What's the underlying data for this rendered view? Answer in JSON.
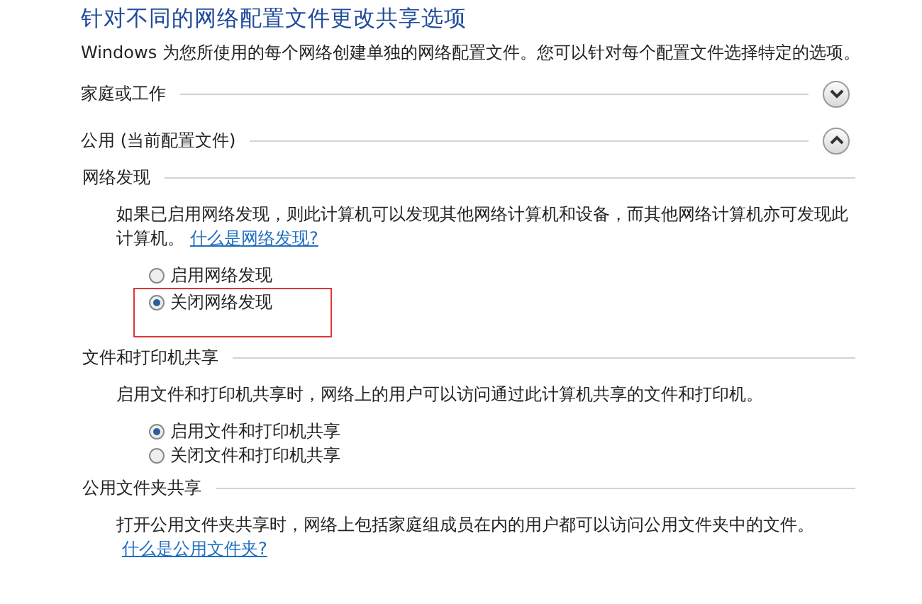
{
  "title": "针对不同的网络配置文件更改共享选项",
  "description": "Windows 为您所使用的每个网络创建单独的网络配置文件。您可以针对每个配置文件选择特定的选项。",
  "profiles": [
    {
      "label": "家庭或工作",
      "expanded": false
    },
    {
      "label": "公用 (当前配置文件)",
      "expanded": true,
      "sections": [
        {
          "heading": "网络发现",
          "text": "如果已启用网络发现，则此计算机可以发现其他网络计算机和设备，而其他网络计算机亦可发现此计算机。",
          "link": "什么是网络发现?",
          "options": [
            {
              "label": "启用网络发现",
              "selected": false,
              "highlighted": false
            },
            {
              "label": "关闭网络发现",
              "selected": true,
              "highlighted": true
            }
          ]
        },
        {
          "heading": "文件和打印机共享",
          "text": "启用文件和打印机共享时，网络上的用户可以访问通过此计算机共享的文件和打印机。",
          "options": [
            {
              "label": "启用文件和打印机共享",
              "selected": true,
              "highlighted": false
            },
            {
              "label": "关闭文件和打印机共享",
              "selected": false,
              "highlighted": false
            }
          ]
        },
        {
          "heading": "公用文件夹共享",
          "text": "打开公用文件夹共享时，网络上包括家庭组成员在内的用户都可以访问公用文件夹中的文件。",
          "link": "什么是公用文件夹?"
        }
      ]
    }
  ]
}
